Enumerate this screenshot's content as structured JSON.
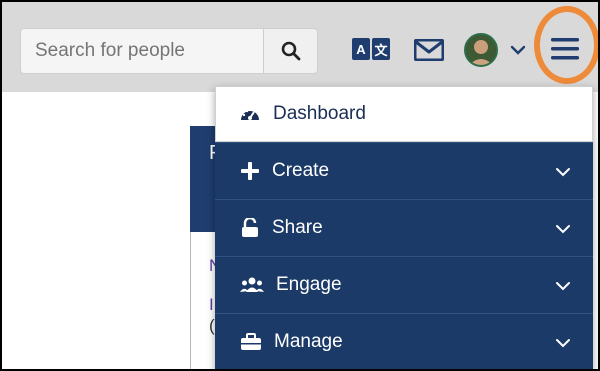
{
  "search": {
    "placeholder": "Search for people"
  },
  "header": {
    "translate_icon": "translate-icon",
    "mail_icon": "envelope-icon",
    "avatar_icon": "user-avatar",
    "menu_icon": "hamburger-menu-icon"
  },
  "menu": {
    "items": [
      {
        "label": "Dashboard",
        "icon": "dashboard-gauge-icon"
      },
      {
        "label": "Create",
        "icon": "plus-icon"
      },
      {
        "label": "Share",
        "icon": "unlock-icon"
      },
      {
        "label": "Engage",
        "icon": "users-icon"
      },
      {
        "label": "Manage",
        "icon": "briefcase-icon"
      }
    ]
  },
  "colors": {
    "menu_bg": "#1b3a67",
    "topbar_bg": "#d9d9d9",
    "highlight_ring": "#ee8b3a"
  }
}
